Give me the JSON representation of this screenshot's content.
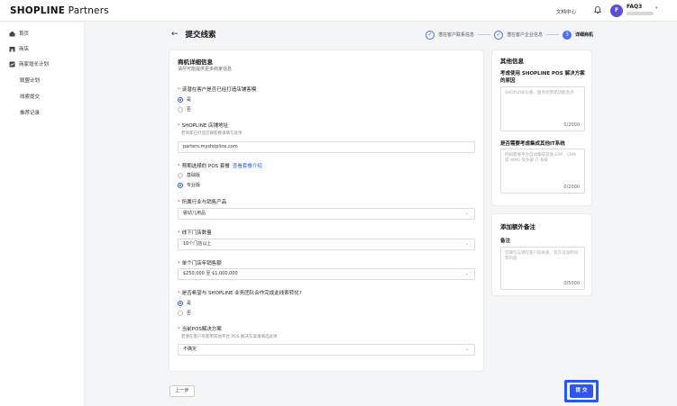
{
  "app": {
    "logo_bold": "SHOPLINE",
    "logo_light": " Partners",
    "doc_center": "文档中心",
    "user_initial": "F",
    "user_name": "FAQ3"
  },
  "sidebar": {
    "items": [
      {
        "label": "首页",
        "icon": "home-icon"
      },
      {
        "label": "商店",
        "icon": "store-icon"
      },
      {
        "label": "商家增长计划",
        "icon": "growth-icon"
      }
    ],
    "sub_items": [
      {
        "label": "联盟计划"
      },
      {
        "label": "线索提交"
      },
      {
        "label": "推荐记录"
      }
    ]
  },
  "header": {
    "back": "←",
    "title": "提交线索"
  },
  "steps": [
    {
      "label": "潜在客户联系信息",
      "state": "done"
    },
    {
      "label": "潜在客户企业信息",
      "state": "done"
    },
    {
      "label": "3",
      "text": "详细商机",
      "state": "active"
    }
  ],
  "form": {
    "title": "商机详细信息",
    "subtitle": "请尽可能提供更多商家信息",
    "q1": {
      "label": "该潜在客户是否已经打造店铺客模",
      "options": [
        "是",
        "否"
      ],
      "selected": 0
    },
    "q2": {
      "label": "SHOPLINE 店铺地址",
      "help": "若商家已打造店铺客模请填写此项",
      "value": "parters.myshopline.com"
    },
    "q3": {
      "label": "预期选择的 POS 套餐",
      "link": "查看套餐介绍",
      "options": [
        "基础版",
        "专业版"
      ],
      "selected": 1
    },
    "q4": {
      "label": "所属行业与销售产品",
      "value": "婴幼儿用品"
    },
    "q5": {
      "label": "线下门店数量",
      "value": "10个门店以上"
    },
    "q6": {
      "label": "单个门店年销售额",
      "value": "$250,000 至 $1,000,000"
    },
    "q7": {
      "label": "是否希望与 SHOPLINE 业务团队合作完成此线索转化?",
      "options": [
        "是",
        "否"
      ],
      "selected": 0
    },
    "q8": {
      "label": "当前POS解决方案",
      "help": "若潜在客户有使用其他平台 POS 解决方案请填选此项",
      "value": "不确定"
    }
  },
  "other_info": {
    "title": "其他信息",
    "q1_label": "考虑使用 SHOPLINE POS 解决方案的原因",
    "q1_placeholder": "SHOPLINE价格、服务优势或功能亮点",
    "q1_count": "0/2000",
    "q2_label": "是否需要考虑集成其他IT系统",
    "q2_placeholder": "例如需要平台自动集成其他 ERP、CRM 或 WMS 等外部 IT 系统",
    "q2_count": "0/2000"
  },
  "notes": {
    "title": "添加额外备注",
    "label": "备注",
    "placeholder": "可填写与潜在客户的关系、双方洽谈时间等内容",
    "count": "0/5000"
  },
  "actions": {
    "prev": "上一步",
    "submit": "提 交"
  }
}
